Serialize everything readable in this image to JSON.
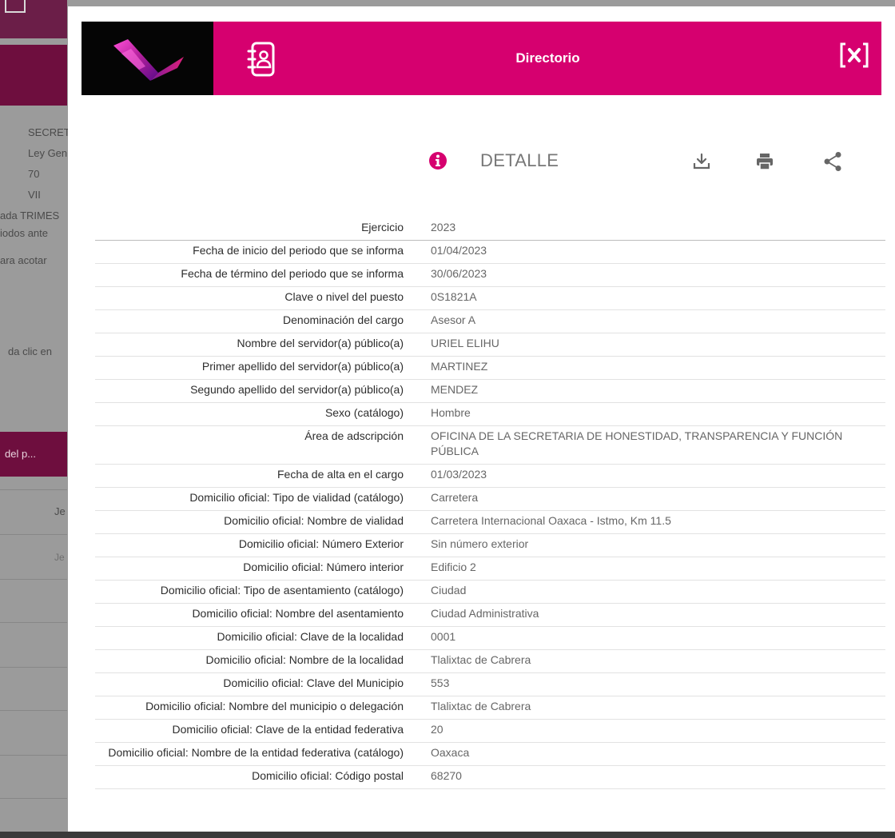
{
  "background": {
    "side_texts": [
      "SECRETA",
      "Ley Gen",
      "70",
      "VII",
      "ada TRIMES",
      "iodos ante",
      "ara acotar",
      "da clic en"
    ],
    "band_text": "del p...",
    "row_texts": [
      "Je",
      "Je"
    ]
  },
  "modal": {
    "title": "Directorio",
    "close_label": "[×]",
    "section_label": "DETALLE",
    "accent_color": "#d6006f"
  },
  "details": [
    {
      "label": "Ejercicio",
      "value": "2023"
    },
    {
      "label": "Fecha de inicio del periodo que se informa",
      "value": "01/04/2023"
    },
    {
      "label": "Fecha de término del periodo que se informa",
      "value": "30/06/2023"
    },
    {
      "label": "Clave o nivel del puesto",
      "value": "0S1821A"
    },
    {
      "label": "Denominación del cargo",
      "value": "Asesor A"
    },
    {
      "label": "Nombre del servidor(a) público(a)",
      "value": "URIEL ELIHU"
    },
    {
      "label": "Primer apellido del servidor(a) público(a)",
      "value": "MARTINEZ"
    },
    {
      "label": "Segundo apellido del servidor(a) público(a)",
      "value": "MENDEZ"
    },
    {
      "label": "Sexo (catálogo)",
      "value": "Hombre"
    },
    {
      "label": "Área de adscripción",
      "value": "OFICINA DE LA SECRETARIA DE HONESTIDAD, TRANSPARENCIA Y FUNCIÓN PÚBLICA"
    },
    {
      "label": "Fecha de alta en el cargo",
      "value": "01/03/2023"
    },
    {
      "label": "Domicilio oficial: Tipo de vialidad (catálogo)",
      "value": "Carretera"
    },
    {
      "label": "Domicilio oficial: Nombre de vialidad",
      "value": "Carretera Internacional Oaxaca - Istmo, Km 11.5"
    },
    {
      "label": "Domicilio oficial: Número Exterior",
      "value": "Sin número exterior"
    },
    {
      "label": "Domicilio oficial: Número interior",
      "value": "Edificio 2"
    },
    {
      "label": "Domicilio oficial: Tipo de asentamiento (catálogo)",
      "value": "Ciudad"
    },
    {
      "label": "Domicilio oficial: Nombre del asentamiento",
      "value": "Ciudad Administrativa"
    },
    {
      "label": "Domicilio oficial: Clave de la localidad",
      "value": "0001"
    },
    {
      "label": "Domicilio oficial: Nombre de la localidad",
      "value": "Tlalixtac de Cabrera"
    },
    {
      "label": "Domicilio oficial: Clave del Municipio",
      "value": "553"
    },
    {
      "label": "Domicilio oficial: Nombre del municipio o delegación",
      "value": "Tlalixtac de Cabrera"
    },
    {
      "label": "Domicilio oficial: Clave de la entidad federativa",
      "value": "20"
    },
    {
      "label": "Domicilio oficial: Nombre de la entidad federativa (catálogo)",
      "value": "Oaxaca"
    },
    {
      "label": "Domicilio oficial: Código postal",
      "value": "68270"
    }
  ]
}
